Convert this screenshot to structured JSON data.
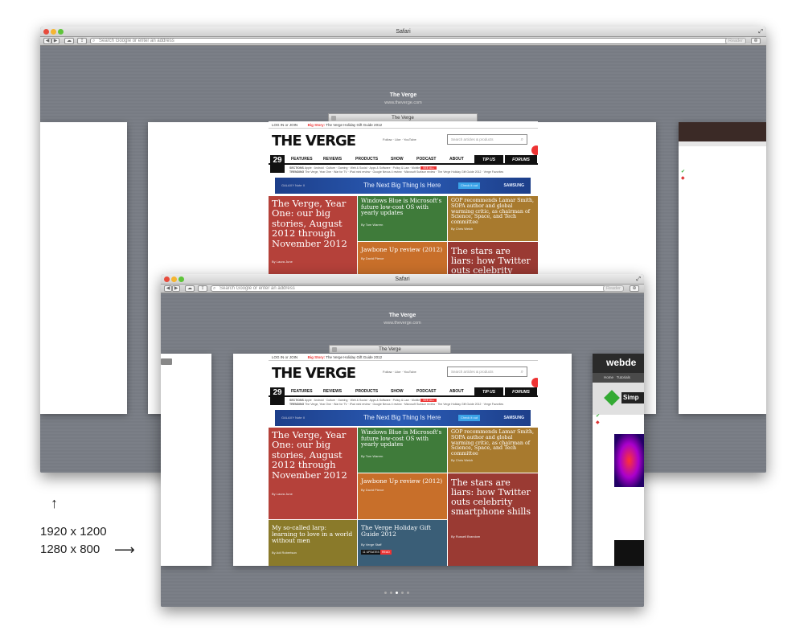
{
  "big_window": {
    "title": "Safari",
    "address_placeholder": "Search Google or enter an address",
    "reader_label": "Reader",
    "page_title": "The Verge",
    "page_url": "www.theverge.com",
    "tab_title": "The Verge"
  },
  "small_window": {
    "title": "Safari",
    "address_placeholder": "Search Google or enter an address",
    "reader_label": "Reader",
    "page_title": "The Verge",
    "page_url": "www.theverge.com",
    "tab_title": "The Verge",
    "right_site_label": "webde",
    "right_site_nav": [
      "Home",
      "Tutorials"
    ],
    "right_site_sub": "Simp"
  },
  "verge": {
    "login": "LOG IN",
    "or": "or",
    "join": "JOIN",
    "big_story_label": "Big Story:",
    "big_story": "The Verge Holiday Gift Guide 2012",
    "logo": "THE VERGE",
    "social": [
      "Follow",
      "Like",
      "YouTube"
    ],
    "search_placeholder": "Search articles & products",
    "date": "29",
    "nav": [
      "FEATURES",
      "REVIEWS",
      "PRODUCTS",
      "SHOW",
      "PODCAST",
      "ABOUT"
    ],
    "tip_us": "TIP US",
    "forums": "FORUMS",
    "sections_label": "SECTIONS",
    "sections": [
      "Apple",
      "Android",
      "Culture",
      "Gaming",
      "Web & Social",
      "Apps & Software",
      "Policy & Law",
      "Mobile"
    ],
    "see_all": "SEE ALL",
    "trending_label": "TRENDING",
    "trending": [
      "The Verge, Year One",
      "War for TV",
      "iPad mini review",
      "Google Nexus 4 review",
      "Microsoft Surface review",
      "The Verge Holiday Gift Guide 2012",
      "Verge Favorites"
    ],
    "banner_product": "GALAXY Note II",
    "banner_text": "The Next Big Thing Is Here",
    "banner_cta": "Check it out",
    "banner_brand": "SAMSUNG",
    "tiles": [
      {
        "headline": "The Verge, Year One: our big stories, August 2012 through November 2012",
        "byline": "By Laura June",
        "color": "#b5413a"
      },
      {
        "headline": "Windows Blue is Microsoft's future low-cost OS with yearly updates",
        "byline": "By Tom Warren",
        "color": "#3f7b3a"
      },
      {
        "headline": "GOP recommends Lamar Smith, SOPA author and global warming critic, as chairman of Science, Space, and Tech committee",
        "byline": "By Chris Welch",
        "color": "#a87a2e"
      },
      {
        "headline": "Jawbone Up review (2012)",
        "byline": "By David Pierce",
        "color": "#c86f2a"
      },
      {
        "headline": "The stars are liars: how Twitter outs celebrity smartphone shills",
        "byline": "By Russell Brandom",
        "color": "#9a3a33"
      },
      {
        "headline": "My so-called larp: learning to love in a world without men",
        "byline": "By Adi Robertson",
        "color": "#8a7a2a"
      },
      {
        "headline": "The Verge Holiday Gift Guide 2012",
        "byline": "By Verge Staff",
        "color": "#3a5e77"
      }
    ],
    "updated_badge": "11 UPDATES",
    "read_badge": "READ"
  },
  "annotations": {
    "big_size": "1920 x 1200",
    "small_size": "1280 x 800"
  },
  "colors": {
    "desktop_gray": "#777b83",
    "verge_red": "#e33333"
  }
}
